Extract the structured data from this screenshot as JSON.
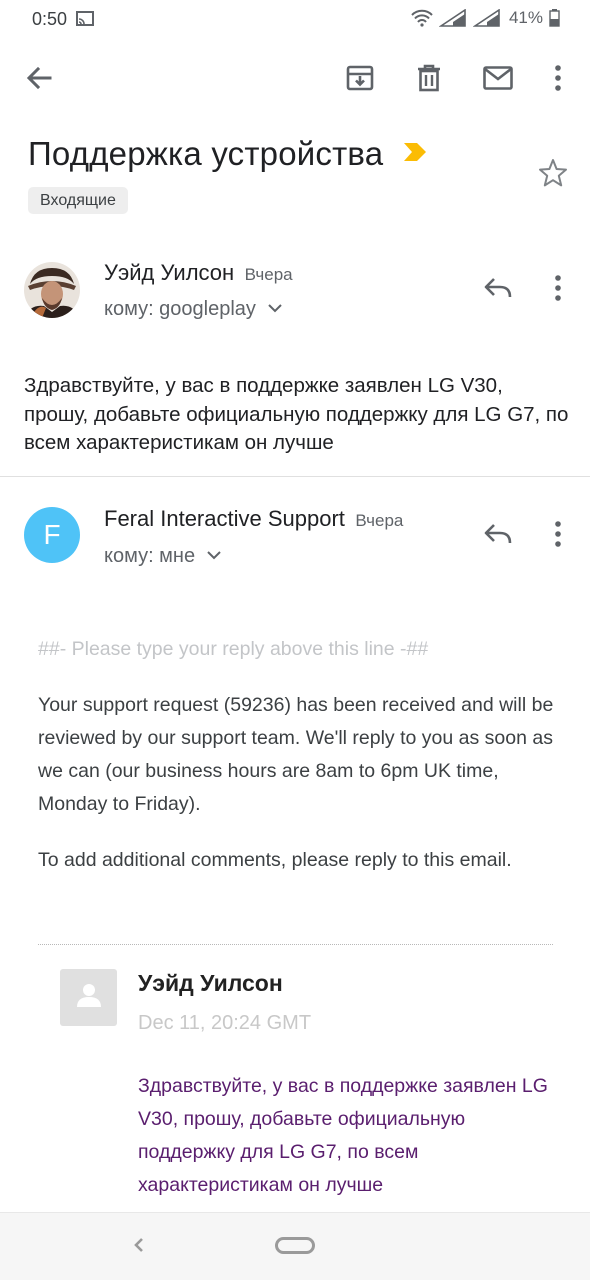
{
  "status_bar": {
    "time": "0:50",
    "battery": "41%"
  },
  "toolbar": {
    "icons": [
      "back-arrow-icon",
      "archive-icon",
      "delete-icon",
      "mark-unread-icon",
      "more-vert-icon"
    ]
  },
  "email": {
    "subject": "Поддержка устройства",
    "label": "Входящие",
    "accent_color": "#fbbc04"
  },
  "messages": [
    {
      "sender": "Уэйд Уилсон",
      "date": "Вчера",
      "recipient": "кому: googleplay",
      "body": "Здравствуйте, у вас в поддержке заявлен LG V30, прошу, добавьте официальную поддержку для LG G7, по всем характеристикам он лучше"
    },
    {
      "sender": "Feral Interactive Support",
      "avatar_letter": "F",
      "avatar_color": "#4fc3f7",
      "date": "Вчера",
      "recipient": "кому: мне",
      "reply_separator": "##- Please type your reply above this line -##",
      "paragraph_1": "Your support request (59236) has been received and will be reviewed by our support team. We'll reply to you as soon as we can (our business hours are 8am to 6pm UK time, Monday to Friday).",
      "paragraph_2": "To add additional comments, please reply to this email.",
      "quoted": {
        "name": "Уэйд Уилсон",
        "date": "Dec 11, 20:24 GMT",
        "body": "Здравствуйте, у вас в поддержке заявлен LG V30, прошу, добавьте официальную поддержку для LG G7, по всем характеристикам он лучше",
        "body_color": "#5a1e6e"
      }
    }
  ]
}
